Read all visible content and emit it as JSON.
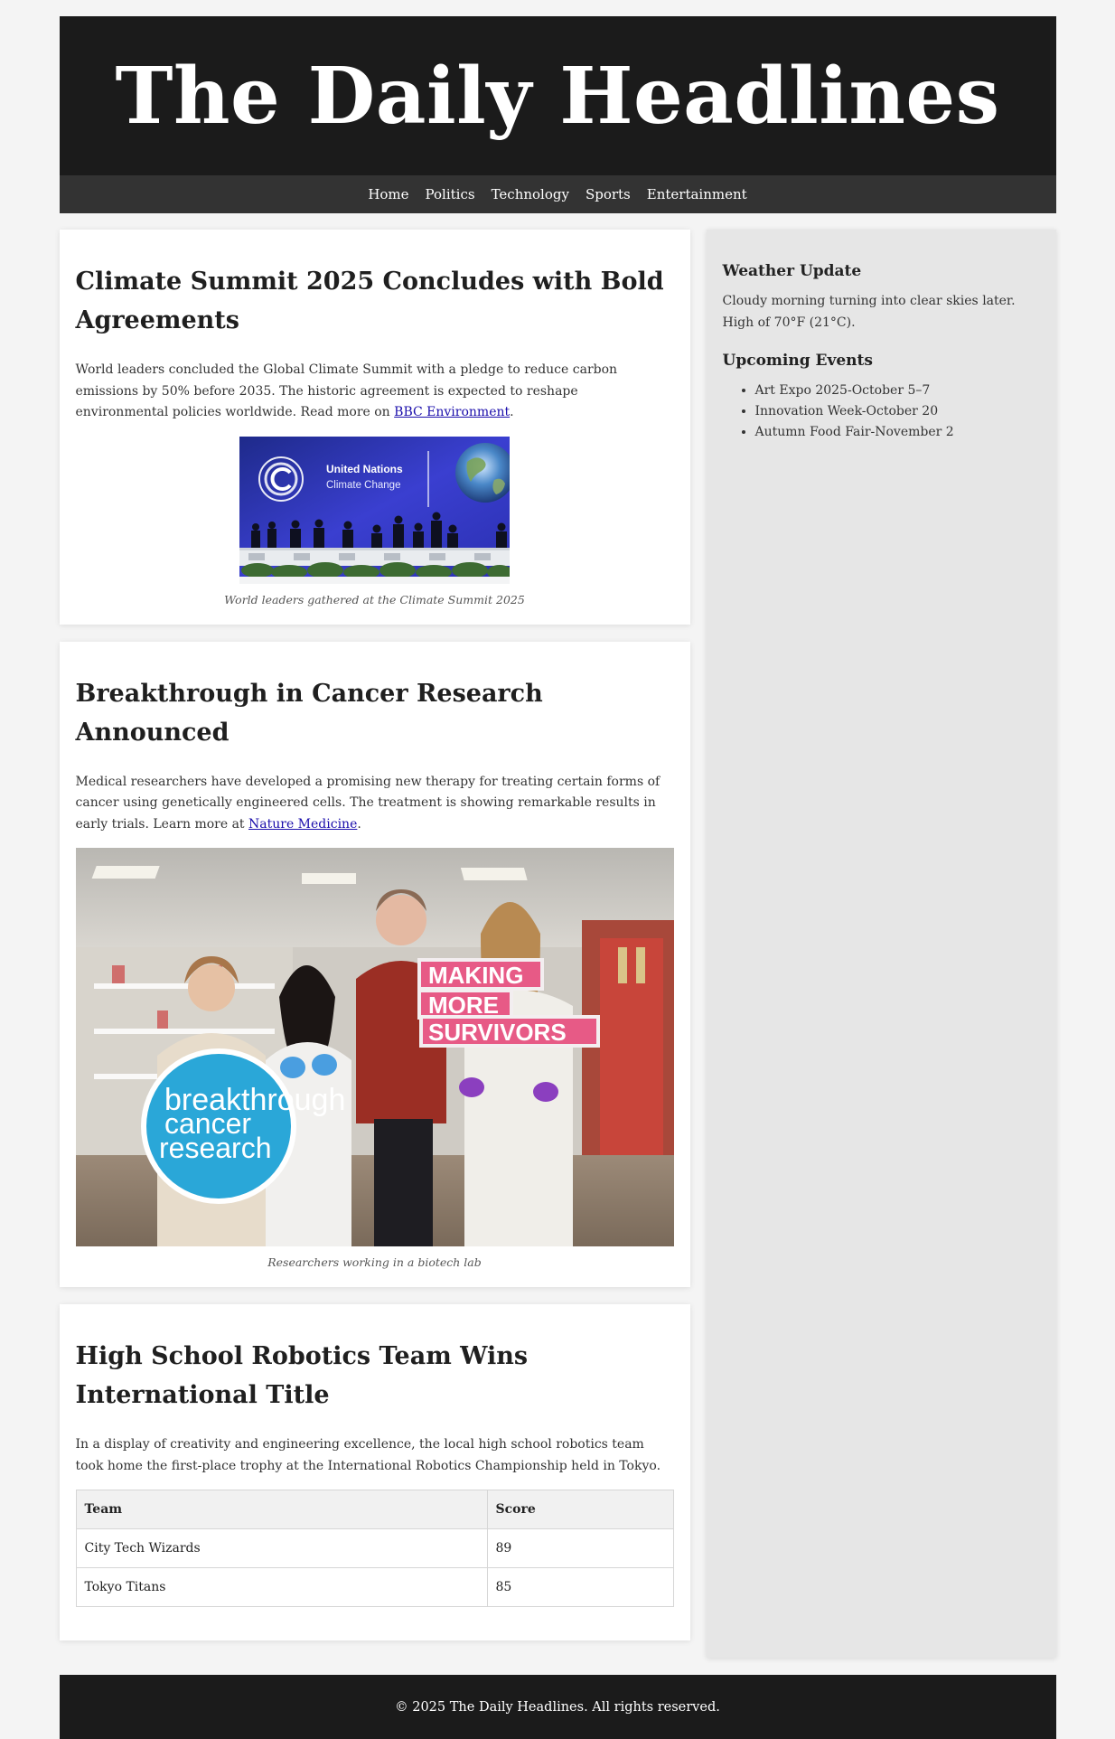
{
  "site": {
    "title": "The Daily Headlines"
  },
  "nav": {
    "items": [
      {
        "label": "Home"
      },
      {
        "label": "Politics"
      },
      {
        "label": "Technology"
      },
      {
        "label": "Sports"
      },
      {
        "label": "Entertainment"
      }
    ]
  },
  "articles": [
    {
      "title": "Climate Summit 2025 Concludes with Bold Agreements",
      "body": "World leaders concluded the Global Climate Summit with a pledge to reduce carbon emissions by 50% before 2035. The historic agreement is expected to reshape environmental policies worldwide. Read more on ",
      "link_text": "BBC Environment",
      "after_link": ".",
      "image": {
        "banner_line1": "United Nations",
        "banner_line2": "Climate Change"
      },
      "caption": "World leaders gathered at the Climate Summit 2025"
    },
    {
      "title": "Breakthrough in Cancer Research Announced",
      "body": "Medical researchers have developed a promising new therapy for treating certain forms of cancer using genetically engineered cells. The treatment is showing remarkable results in early trials. Learn more at ",
      "link_text": "Nature Medicine",
      "after_link": ".",
      "image": {
        "circle_line1": "breakthrough",
        "circle_line2": "cancer",
        "circle_line3": "research",
        "sign_line1": "MAKING",
        "sign_line2": "MORE",
        "sign_line3": "SURVIVORS"
      },
      "caption": "Researchers working in a biotech lab"
    },
    {
      "title": "High School Robotics Team Wins International Title",
      "body": "In a display of creativity and engineering excellence, the local high school robotics team took home the first-place trophy at the International Robotics Championship held in Tokyo.",
      "table": {
        "headers": [
          "Team",
          "Score"
        ],
        "rows": [
          [
            "City Tech Wizards",
            "89"
          ],
          [
            "Tokyo Titans",
            "85"
          ]
        ]
      }
    }
  ],
  "sidebar": {
    "weather_title": "Weather Update",
    "weather_text": "Cloudy morning turning into clear skies later. High of 70°F (21°C).",
    "events_title": "Upcoming Events",
    "events": [
      "Art Expo 2025-October 5–7",
      "Innovation Week-October 20",
      "Autumn Food Fair-November 2"
    ]
  },
  "footer": {
    "text": "© 2025 The Daily Headlines. All rights reserved."
  },
  "colors": {
    "header_bg": "#1b1b1b",
    "nav_bg": "#333333",
    "sidebar_bg": "#e6e6e6",
    "link": "#1a0dab",
    "page_bg": "#f4f4f4"
  }
}
